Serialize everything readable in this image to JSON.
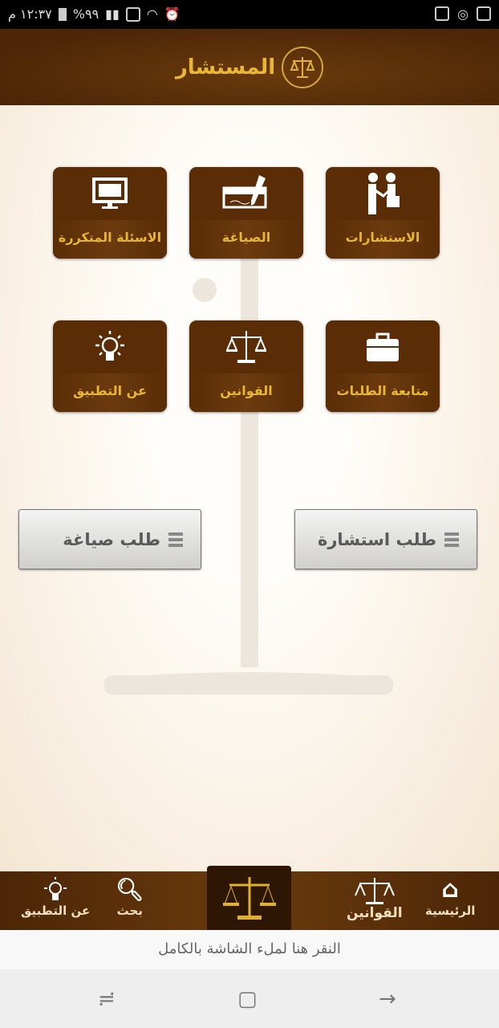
{
  "status_bar": {
    "time": "١٢:٣٧ م",
    "battery": "%٩٩"
  },
  "header": {
    "title": "المستشار"
  },
  "tiles": [
    {
      "label": "الاستشارات",
      "icon": "handshake-icon"
    },
    {
      "label": "الصياغة",
      "icon": "pen-document-icon"
    },
    {
      "label": "الاسئلة المتكررة",
      "icon": "monitor-icon"
    },
    {
      "label": "متابعة الطلبات",
      "icon": "briefcase-icon"
    },
    {
      "label": "القوانين",
      "icon": "scales-icon"
    },
    {
      "label": "عن التطبيق",
      "icon": "lightbulb-icon"
    }
  ],
  "buttons": {
    "consultation_request": "طلب استشارة",
    "drafting_request": "طلب صياغة"
  },
  "bottom_nav": [
    {
      "label": "الرئيسية",
      "icon": "home-icon"
    },
    {
      "label": "القوانين",
      "icon": "scales-icon"
    },
    {
      "label": "",
      "icon": "scales-icon"
    },
    {
      "label": "بحث",
      "icon": "search-icon"
    },
    {
      "label": "عن التطبيق",
      "icon": "lightbulb-icon"
    }
  ],
  "banner": {
    "text": "النقر هنا لملء الشاشة بالكامل"
  },
  "colors": {
    "brown": "#5a2d06",
    "gold": "#e8b732"
  }
}
